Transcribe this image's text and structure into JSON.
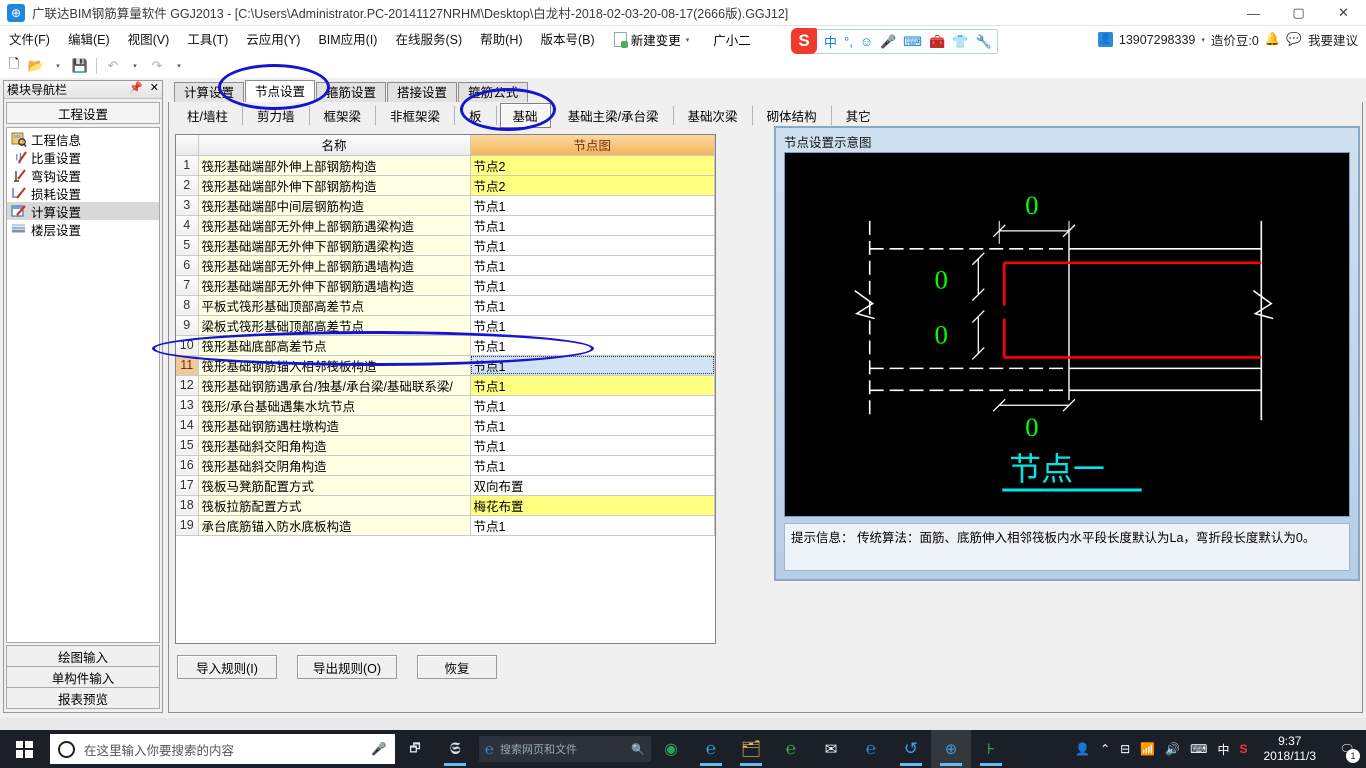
{
  "titlebar": {
    "app_icon": "app-logo-icon",
    "title": "广联达BIM钢筋算量软件 GGJ2013 - [C:\\Users\\Administrator.PC-20141127NRHM\\Desktop\\白龙村-2018-02-03-20-08-17(2666版).GGJ12]",
    "minimize": "—",
    "maximize": "▢",
    "close": "✕"
  },
  "menubar": {
    "items": [
      "文件(F)",
      "编辑(E)",
      "视图(V)",
      "工具(T)",
      "云应用(Y)",
      "BIM应用(I)",
      "在线服务(S)",
      "帮助(H)",
      "版本号(B)"
    ],
    "new_change": "新建变更",
    "new_change_caret": "▾",
    "user": "广小二"
  },
  "ime": {
    "logo": "S",
    "mode": "中",
    "punct": "°,",
    "emoji": "☺",
    "mic": "🎤",
    "keyboard": "⌨",
    "toolbox": "🧰",
    "skin": "👕",
    "settings": "🔧"
  },
  "account": {
    "avatar": "👤",
    "phone": "13907298339",
    "caret": "▾",
    "coins": "造价豆:0",
    "bell": "🔔",
    "feedback": "我要建议"
  },
  "toolbar": {
    "new": "new-file-icon",
    "open": "open-folder-icon",
    "open_caret": "▾",
    "save": "save-icon",
    "undo": "undo-icon",
    "undo_caret": "▾",
    "redo": "redo-icon",
    "redo_caret": "▾"
  },
  "sidebar": {
    "header": "模块导航栏",
    "pin": "📌",
    "close": "✕",
    "group": "工程设置",
    "items": [
      {
        "label": "工程信息",
        "icon": "project-info-icon",
        "selected": false
      },
      {
        "label": "比重设置",
        "icon": "weight-settings-icon",
        "selected": false
      },
      {
        "label": "弯钩设置",
        "icon": "hook-settings-icon",
        "selected": false
      },
      {
        "label": "损耗设置",
        "icon": "loss-settings-icon",
        "selected": false
      },
      {
        "label": "计算设置",
        "icon": "calc-settings-icon",
        "selected": true
      },
      {
        "label": "楼层设置",
        "icon": "floor-settings-icon",
        "selected": false
      }
    ],
    "footer_buttons": [
      "绘图输入",
      "单构件输入",
      "报表预览"
    ]
  },
  "main": {
    "tabs_primary": [
      {
        "label": "计算设置",
        "active": false
      },
      {
        "label": "节点设置",
        "active": true
      },
      {
        "label": "箍筋设置",
        "active": false
      },
      {
        "label": "搭接设置",
        "active": false
      },
      {
        "label": "箍筋公式",
        "active": false
      }
    ],
    "tabs_secondary": [
      {
        "label": "柱/墙柱",
        "active": false
      },
      {
        "label": "剪力墙",
        "active": false
      },
      {
        "label": "框架梁",
        "active": false
      },
      {
        "label": "非框架梁",
        "active": false
      },
      {
        "label": "板",
        "active": false
      },
      {
        "label": "基础",
        "active": true
      },
      {
        "label": "基础主梁/承台梁",
        "active": false
      },
      {
        "label": "基础次梁",
        "active": false
      },
      {
        "label": "砌体结构",
        "active": false
      },
      {
        "label": "其它",
        "active": false
      }
    ],
    "grid": {
      "columns": [
        "",
        "名称",
        "节点图"
      ],
      "rows": [
        {
          "idx": "1",
          "name": "筏形基础端部外伸上部钢筋构造",
          "value": "节点2",
          "highlight": true,
          "selected": false
        },
        {
          "idx": "2",
          "name": "筏形基础端部外伸下部钢筋构造",
          "value": "节点2",
          "highlight": true,
          "selected": false
        },
        {
          "idx": "3",
          "name": "筏形基础端部中间层钢筋构造",
          "value": "节点1",
          "highlight": false,
          "selected": false
        },
        {
          "idx": "4",
          "name": "筏形基础端部无外伸上部钢筋遇梁构造",
          "value": "节点1",
          "highlight": false,
          "selected": false
        },
        {
          "idx": "5",
          "name": "筏形基础端部无外伸下部钢筋遇梁构造",
          "value": "节点1",
          "highlight": false,
          "selected": false
        },
        {
          "idx": "6",
          "name": "筏形基础端部无外伸上部钢筋遇墙构造",
          "value": "节点1",
          "highlight": false,
          "selected": false
        },
        {
          "idx": "7",
          "name": "筏形基础端部无外伸下部钢筋遇墙构造",
          "value": "节点1",
          "highlight": false,
          "selected": false
        },
        {
          "idx": "8",
          "name": "平板式筏形基础顶部高差节点",
          "value": "节点1",
          "highlight": false,
          "selected": false
        },
        {
          "idx": "9",
          "name": "梁板式筏形基础顶部高差节点",
          "value": "节点1",
          "highlight": false,
          "selected": false
        },
        {
          "idx": "10",
          "name": "筏形基础底部高差节点",
          "value": "节点1",
          "highlight": false,
          "selected": false
        },
        {
          "idx": "11",
          "name": "筏形基础钢筋锚入相邻筏板构造",
          "value": "节点1",
          "highlight": false,
          "selected": true
        },
        {
          "idx": "12",
          "name": "筏形基础钢筋遇承台/独基/承台梁/基础联系梁/",
          "value": "节点1",
          "highlight": true,
          "selected": false
        },
        {
          "idx": "13",
          "name": "筏形/承台基础遇集水坑节点",
          "value": "节点1",
          "highlight": false,
          "selected": false
        },
        {
          "idx": "14",
          "name": "筏形基础钢筋遇柱墩构造",
          "value": "节点1",
          "highlight": false,
          "selected": false
        },
        {
          "idx": "15",
          "name": "筏形基础斜交阳角构造",
          "value": "节点1",
          "highlight": false,
          "selected": false
        },
        {
          "idx": "16",
          "name": "筏形基础斜交阴角构造",
          "value": "节点1",
          "highlight": false,
          "selected": false
        },
        {
          "idx": "17",
          "name": "筏板马凳筋配置方式",
          "value": "双向布置",
          "highlight": false,
          "selected": false
        },
        {
          "idx": "18",
          "name": "筏板拉筋配置方式",
          "value": "梅花布置",
          "highlight": true,
          "selected": false
        },
        {
          "idx": "19",
          "name": "承台底筋锚入防水底板构造",
          "value": "节点1",
          "highlight": false,
          "selected": false
        }
      ]
    },
    "buttons": [
      {
        "label": "导入规则(I)"
      },
      {
        "label": "导出规则(O)"
      },
      {
        "label": "恢复"
      }
    ],
    "preview": {
      "title": "节点设置示意图",
      "diagram": {
        "dim_top": "0",
        "dim_bottom": "0",
        "dim_left_upper": "0",
        "dim_left_lower": "0",
        "caption": "节点一",
        "colors": {
          "background": "#000000",
          "rebar": "#ff0000",
          "outline": "#ffffff",
          "dimension_text": "#00ff00",
          "caption": "#00e5e5"
        }
      },
      "hint_label": "提示信息：",
      "hint_text": "传统算法：面筋、底筋伸入相邻筏板内水平段长度默认为La，弯折段长度默认为0。"
    }
  },
  "annotations": {
    "color": "#1414d2",
    "ellipses": [
      {
        "name": "annotation-node-settings-tab"
      },
      {
        "name": "annotation-foundation-tab"
      },
      {
        "name": "annotation-row-11"
      }
    ]
  },
  "taskbar": {
    "start": "start-button",
    "search_placeholder": "在这里输入你要搜索的内容",
    "mic": "microphone-icon",
    "taskview": "task-view-icon",
    "edge_search_text": "搜索网页和文件",
    "apps": [
      "wps-icon",
      "edge-search-box",
      "360-icon",
      "ie-icon",
      "explorer-icon",
      "browser-icon",
      "mail-icon",
      "edge-icon",
      "360se-icon",
      "glodon-icon",
      "app-icon"
    ],
    "tray": [
      "people-icon",
      "chevron-up-icon",
      "usb-icon",
      "wifi-icon",
      "volume-icon",
      "keyboard-icon",
      "ime-cn-icon",
      "sogou-icon"
    ],
    "clock_time": "9:37",
    "clock_date": "2018/11/3",
    "notif_count": "1"
  }
}
